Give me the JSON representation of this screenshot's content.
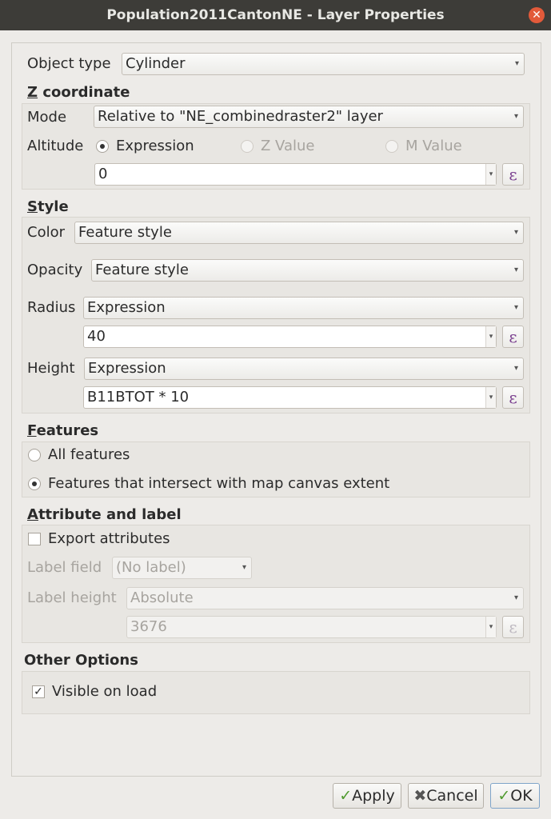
{
  "window": {
    "title": "Population2011CantonNE - Layer Properties"
  },
  "object_type": {
    "label": "Object type",
    "value": "Cylinder"
  },
  "z_coordinate": {
    "title": "Z coordinate",
    "mode_label": "Mode",
    "mode_value": "Relative to \"NE_combinedraster2\" layer",
    "altitude_label": "Altitude",
    "radio_expression": "Expression",
    "radio_z_value": "Z Value",
    "radio_m_value": "M Value",
    "expression_value": "0"
  },
  "style": {
    "title": "Style",
    "color_label": "Color",
    "color_value": "Feature style",
    "opacity_label": "Opacity",
    "opacity_value": "Feature style",
    "radius_label": "Radius",
    "radius_mode": "Expression",
    "radius_value": "40",
    "height_label": "Height",
    "height_mode": "Expression",
    "height_value": "B11BTOT * 10"
  },
  "features": {
    "title": "Features",
    "option_all": "All features",
    "option_intersect": "Features that intersect with map canvas extent",
    "selected": "Features that intersect with map canvas extent"
  },
  "attribute_label": {
    "title": "Attribute and label",
    "export_attributes": "Export attributes",
    "export_checked": false,
    "label_field_label": "Label field",
    "label_field_value": "(No label)",
    "label_height_label": "Label height",
    "label_height_value": "Absolute",
    "label_height_number": "3676"
  },
  "other_options": {
    "title": "Other Options",
    "visible_on_load": "Visible on load",
    "visible_checked": true
  },
  "buttons": {
    "apply": "Apply",
    "cancel": "Cancel",
    "ok": "OK"
  },
  "colors": {
    "accent_epsilon": "#7a3f8f",
    "check_green": "#4f9a2e",
    "titlebar": "#3d3c38",
    "close": "#e25a3a"
  }
}
